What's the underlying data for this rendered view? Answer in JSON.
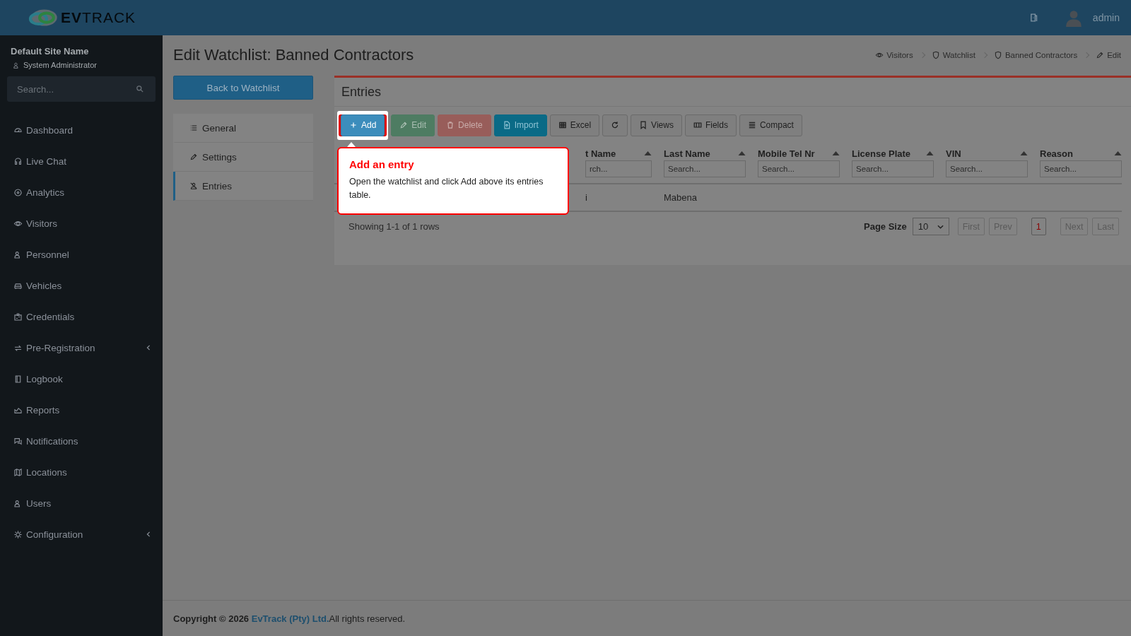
{
  "header": {
    "logo": "**EV**TRACK",
    "user": "admin"
  },
  "sidebar": {
    "site": "Default Site Name",
    "role": "System Administrator",
    "search_placeholder": "Search...",
    "items": [
      {
        "label": "Dashboard",
        "submenu": false
      },
      {
        "label": "Live Chat",
        "submenu": false
      },
      {
        "label": "Analytics",
        "submenu": false
      },
      {
        "label": "Visitors",
        "submenu": false
      },
      {
        "label": "Personnel",
        "submenu": false
      },
      {
        "label": "Vehicles",
        "submenu": false
      },
      {
        "label": "Credentials",
        "submenu": false
      },
      {
        "label": "Pre-Registration",
        "submenu": true
      },
      {
        "label": "Logbook",
        "submenu": false
      },
      {
        "label": "Reports",
        "submenu": false
      },
      {
        "label": "Notifications",
        "submenu": false
      },
      {
        "label": "Locations",
        "submenu": false
      },
      {
        "label": "Users",
        "submenu": false
      },
      {
        "label": "Configuration",
        "submenu": true
      }
    ]
  },
  "page": {
    "title": "Edit Watchlist: Banned Contractors",
    "breadcrumbs": [
      "Visitors",
      "Watchlist",
      "Banned Contractors",
      "Edit"
    ],
    "back_button": "Back to Watchlist",
    "tabs": [
      {
        "label": "General",
        "selected": false
      },
      {
        "label": "Settings",
        "selected": false
      },
      {
        "label": "Entries",
        "selected": true
      }
    ]
  },
  "panel": {
    "title": "Entries",
    "toolbar": [
      {
        "label": "Add",
        "kind": "primary",
        "disabled": false,
        "highlighted": true
      },
      {
        "label": "Edit",
        "kind": "success",
        "disabled": true,
        "highlighted": false
      },
      {
        "label": "Delete",
        "kind": "danger",
        "disabled": true,
        "highlighted": false
      },
      {
        "label": "Import",
        "kind": "info",
        "disabled": false,
        "highlighted": false
      },
      {
        "label": "Excel",
        "kind": "default",
        "disabled": false,
        "highlighted": false
      },
      {
        "kind": "default",
        "disabled": false,
        "highlighted": false
      },
      {
        "label": "Views",
        "kind": "default",
        "disabled": false,
        "highlighted": false
      },
      {
        "label": "Fields",
        "kind": "default",
        "disabled": false,
        "highlighted": false
      },
      {
        "label": "Compact",
        "kind": "default",
        "disabled": false,
        "highlighted": false
      }
    ],
    "columns": [
      {
        "label": "t Name",
        "placeholder": "rch..."
      },
      {
        "label": "Last Name",
        "placeholder": "Search..."
      },
      {
        "label": "Mobile Tel Nr",
        "placeholder": "Search..."
      },
      {
        "label": "License Plate",
        "placeholder": "Search..."
      },
      {
        "label": "VIN",
        "placeholder": "Search..."
      },
      {
        "label": "Reason",
        "placeholder": "Search..."
      }
    ],
    "rows": [
      [
        "i",
        "Mabena",
        "",
        "",
        "",
        ""
      ]
    ],
    "status": "Showing 1-1 of 1 rows",
    "page_size_label": "Page Size",
    "page_size": "10",
    "pager": [
      {
        "label": "First",
        "selected": false,
        "disabled": true
      },
      {
        "label": "Prev",
        "selected": false,
        "disabled": true
      },
      {
        "label": "1",
        "selected": true,
        "disabled": false
      },
      {
        "label": "Next",
        "selected": false,
        "disabled": true
      },
      {
        "label": "Last",
        "selected": false,
        "disabled": true
      }
    ]
  },
  "tour": {
    "title": "Add an entry",
    "body": "Open the watchlist and click Add above its entries table."
  },
  "footer": {
    "prefix": "Copyright © 2026",
    "link": "EvTrack (Pty) Ltd.",
    "suffix": "All rights reserved."
  }
}
